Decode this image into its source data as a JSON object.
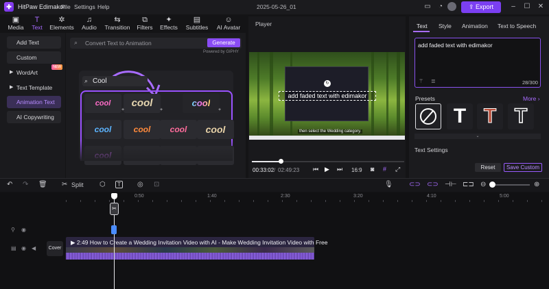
{
  "app": {
    "name": "HitPaw Edimakor",
    "menu": [
      "File",
      "Settings",
      "Help"
    ],
    "project_name": "2025-05-26_01",
    "export_label": "Export"
  },
  "toolbar_tabs": [
    {
      "label": "Media",
      "icon": "media-icon"
    },
    {
      "label": "Text",
      "icon": "text-icon",
      "active": true
    },
    {
      "label": "Elements",
      "icon": "elements-icon"
    },
    {
      "label": "Audio",
      "icon": "audio-icon"
    },
    {
      "label": "Transition",
      "icon": "transition-icon"
    },
    {
      "label": "Filters",
      "icon": "filters-icon"
    },
    {
      "label": "Effects",
      "icon": "effects-icon"
    },
    {
      "label": "Subtitles",
      "icon": "subtitles-icon"
    },
    {
      "label": "AI Avatar",
      "icon": "ai-avatar-icon"
    }
  ],
  "left_nav": {
    "items": [
      {
        "label": "Add Text"
      },
      {
        "label": "Custom"
      },
      {
        "label": "WordArt",
        "badge": "NEW"
      },
      {
        "label": "Text Template"
      },
      {
        "label": "Animation Text",
        "active": true
      },
      {
        "label": "AI Copywriting"
      }
    ]
  },
  "library": {
    "search_placeholder": "Convert Text to Animation",
    "generate_label": "Generate",
    "powered_by": "Powered by GIPHY",
    "example_query": "Cool",
    "tiles": [
      "cool",
      "cool",
      "cool",
      "cool",
      "cool",
      "cool",
      "cool",
      "cool",
      "",
      "",
      "",
      ""
    ]
  },
  "player": {
    "title": "Player",
    "overlay_text": "add faded text with edimakor",
    "subtitle": "then select the Wedding category.",
    "current_time": "00:33:02",
    "total_time": "02:49:23",
    "aspect_ratio": "16:9",
    "progress_fraction": 0.19
  },
  "right_panel": {
    "tabs": [
      "Text",
      "Style",
      "Animation",
      "Text to Speech"
    ],
    "text_value": "add faded text with edimakor",
    "char_count": "28/300",
    "presets_label": "Presets",
    "more_label": "More",
    "text_settings_label": "Text Settings",
    "reset_label": "Reset",
    "save_custom_label": "Save Custom"
  },
  "timeline": {
    "split_label": "Split",
    "ruler_marks": [
      "0:50",
      "1:40",
      "2:30",
      "3:20",
      "4:10",
      "5:00"
    ],
    "cover_label": "Cover",
    "clip_title": "2:49 How to Create a Wedding Invitation Video with AI - Make Wedding Invitation Video with Free",
    "zoom_level_fraction": 0.05
  },
  "colors": {
    "accent": "#7b3ff2",
    "accent_light": "#a86cff",
    "background": "#141416"
  }
}
